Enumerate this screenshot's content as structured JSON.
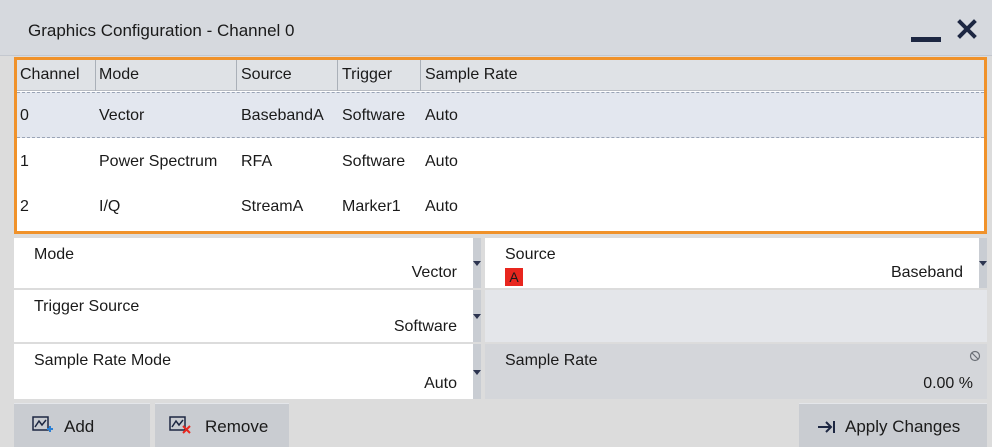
{
  "window": {
    "title": "Graphics Configuration - Channel 0",
    "minimize_icon": "minimize-icon",
    "close_icon": "close-icon"
  },
  "table": {
    "columns": [
      "Channel",
      "Mode",
      "Source",
      "Trigger",
      "Sample Rate"
    ],
    "rows": [
      {
        "channel": "0",
        "mode": "Vector",
        "source": "BasebandA",
        "trigger": "Software",
        "sample_rate": "Auto",
        "selected": true
      },
      {
        "channel": "1",
        "mode": "Power Spectrum",
        "source": "RFA",
        "trigger": "Software",
        "sample_rate": "Auto",
        "selected": false
      },
      {
        "channel": "2",
        "mode": "I/Q",
        "source": "StreamA",
        "trigger": "Marker1",
        "sample_rate": "Auto",
        "selected": false
      }
    ],
    "highlight_color": "#f0922a"
  },
  "form": {
    "mode": {
      "label": "Mode",
      "value": "Vector"
    },
    "source": {
      "label": "Source",
      "badge": "A",
      "value": "Baseband",
      "badge_color": "#e8261e"
    },
    "trigger_source": {
      "label": "Trigger Source",
      "value": "Software"
    },
    "sample_rate_mode": {
      "label": "Sample Rate Mode",
      "value": "Auto"
    },
    "sample_rate": {
      "label": "Sample Rate",
      "value": "0.00 %"
    }
  },
  "buttons": {
    "add": "Add",
    "remove": "Remove",
    "apply": "Apply Changes"
  }
}
